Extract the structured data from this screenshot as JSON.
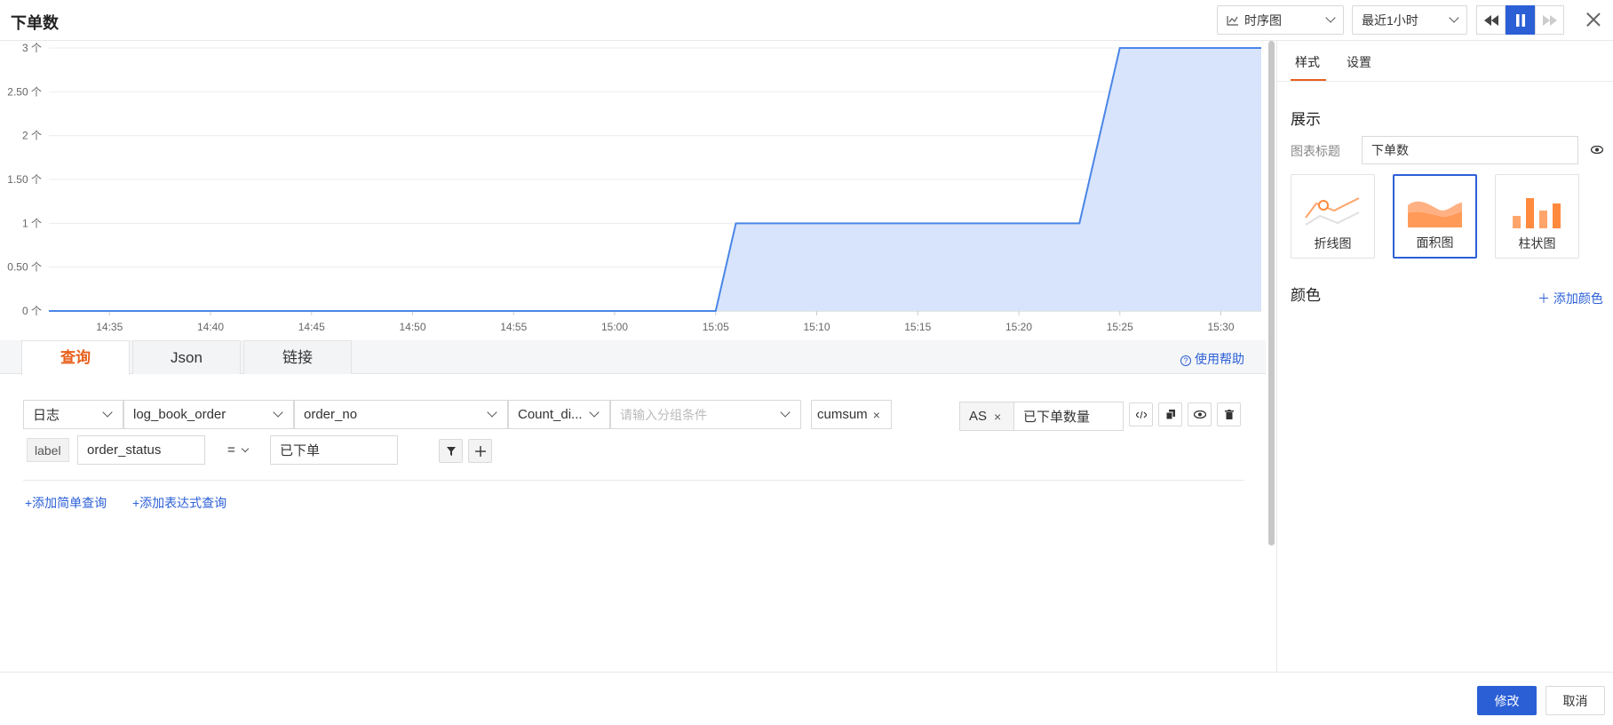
{
  "header": {
    "title": "下单数",
    "chart_type_select": "时序图",
    "time_range_select": "最近1小时"
  },
  "chart_data": {
    "type": "area",
    "x": [
      "15:05",
      "15:06",
      "15:23",
      "15:25",
      "15:32"
    ],
    "x_ticks": [
      "14:35",
      "14:40",
      "14:45",
      "14:50",
      "14:55",
      "15:00",
      "15:05",
      "15:10",
      "15:15",
      "15:20",
      "15:25",
      "15:30"
    ],
    "y_ticks": [
      "0 个",
      "0.50 个",
      "1 个",
      "1.50 个",
      "2 个",
      "2.50 个",
      "3 个"
    ],
    "ylim": [
      0,
      3
    ],
    "series": [
      {
        "values": [
          0,
          1,
          1,
          3,
          3
        ]
      }
    ],
    "flat_before": {
      "from": "14:32",
      "value": 0
    },
    "line_color": "#4a86e8",
    "fill_color": "#d6e3fb"
  },
  "query_tabs": [
    "查询",
    "Json",
    "链接"
  ],
  "help_link": "使用帮助",
  "query": {
    "source": "日志",
    "table": "log_book_order",
    "field": "order_no",
    "agg": "Count_di...",
    "group_placeholder": "请输入分组条件",
    "func_tag": "cumsum",
    "as_label": "AS",
    "alias": "已下单数量",
    "filter": {
      "tag": "label",
      "key": "order_status",
      "op": "=",
      "value": "已下单"
    }
  },
  "add_links": {
    "simple": "+添加简单查询",
    "expr": "+添加表达式查询"
  },
  "panel": {
    "tabs": [
      "样式",
      "设置"
    ],
    "display_title": "展示",
    "chart_title_label": "图表标题",
    "chart_title_value": "下单数",
    "types": [
      "折线图",
      "面积图",
      "柱状图"
    ],
    "selected_type": "面积图",
    "color_title": "颜色",
    "add_color": "添加颜色",
    "accent": "#ff8a3d"
  },
  "footer": {
    "confirm": "修改",
    "cancel": "取消"
  }
}
